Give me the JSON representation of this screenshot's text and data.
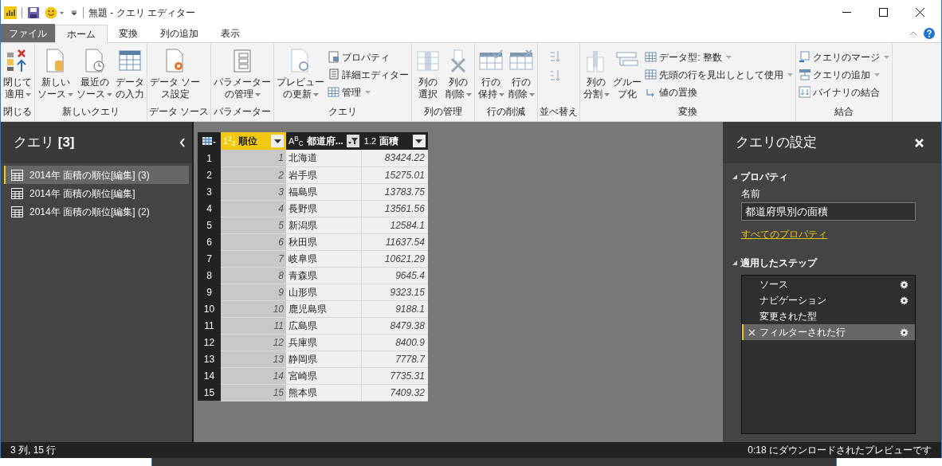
{
  "window": {
    "title": "無題 - クエリ エディター"
  },
  "tabs": [
    {
      "label": "ファイル",
      "kind": "file",
      "selected": false
    },
    {
      "label": "ホーム",
      "kind": "normal",
      "selected": true
    },
    {
      "label": "変換",
      "kind": "normal",
      "selected": false
    },
    {
      "label": "列の追加",
      "kind": "normal",
      "selected": false
    },
    {
      "label": "表示",
      "kind": "normal",
      "selected": false
    }
  ],
  "ribbon": [
    {
      "label": "閉じる",
      "items": [
        {
          "kind": "large",
          "lines": [
            "閉じて",
            "適用"
          ],
          "dropdown": true
        }
      ]
    },
    {
      "label": "新しいクエリ",
      "items": [
        {
          "kind": "large",
          "lines": [
            "新しい",
            "ソース"
          ],
          "dropdown": true
        },
        {
          "kind": "large",
          "lines": [
            "最近の",
            "ソース"
          ],
          "dropdown": true
        },
        {
          "kind": "large",
          "lines": [
            "データ",
            "の入力"
          ],
          "dropdown": false
        }
      ]
    },
    {
      "label": "データ ソース",
      "items": [
        {
          "kind": "large",
          "lines": [
            "データ ソー",
            "ス設定"
          ],
          "dropdown": false
        }
      ]
    },
    {
      "label": "パラメーター",
      "items": [
        {
          "kind": "large",
          "lines": [
            "パラメーター",
            "の管理"
          ],
          "dropdown": true
        }
      ]
    },
    {
      "label": "クエリ",
      "items": [
        {
          "kind": "large",
          "lines": [
            "プレビュー",
            "の更新"
          ],
          "dropdown": true
        },
        {
          "kind": "stack",
          "items": [
            {
              "label": "プロパティ",
              "dropdown": false
            },
            {
              "label": "詳細エディター",
              "dropdown": false
            },
            {
              "label": "管理",
              "dropdown": true
            }
          ]
        }
      ]
    },
    {
      "label": "列の管理",
      "items": [
        {
          "kind": "large",
          "lines": [
            "列の",
            "選択"
          ],
          "dropdown": false
        },
        {
          "kind": "large",
          "lines": [
            "列の",
            "削除"
          ],
          "dropdown": true
        }
      ]
    },
    {
      "label": "行の削減",
      "items": [
        {
          "kind": "large",
          "lines": [
            "行の",
            "保持"
          ],
          "dropdown": true
        },
        {
          "kind": "large",
          "lines": [
            "行の",
            "削除"
          ],
          "dropdown": true
        }
      ]
    },
    {
      "label": "並べ替え",
      "items": [
        {
          "kind": "sort"
        }
      ]
    },
    {
      "label": "変換",
      "items": [
        {
          "kind": "large",
          "lines": [
            "列の",
            "分割"
          ],
          "dropdown": true
        },
        {
          "kind": "large",
          "lines": [
            "グルー",
            "プ化"
          ],
          "dropdown": false
        },
        {
          "kind": "stack",
          "items": [
            {
              "label": "データ型: 整数",
              "dropdown": true
            },
            {
              "label": "先頭の行を見出しとして使用",
              "dropdown": true
            },
            {
              "label": "値の置換",
              "dropdown": false
            }
          ]
        }
      ]
    },
    {
      "label": "結合",
      "items": [
        {
          "kind": "stack",
          "items": [
            {
              "label": "クエリのマージ",
              "dropdown": true
            },
            {
              "label": "クエリの追加",
              "dropdown": true
            },
            {
              "label": "バイナリの結合",
              "dropdown": false
            }
          ]
        }
      ]
    }
  ],
  "queries": {
    "title": "クエリ **[3]**",
    "items": [
      {
        "label": "2014年 面積の順位[編集] (3)",
        "selected": true
      },
      {
        "label": "2014年 面積の順位[編集]",
        "selected": false
      },
      {
        "label": "2014年 面積の順位[編集] (2)",
        "selected": false
      }
    ]
  },
  "table": {
    "columns": [
      {
        "type": "1$^{2}$$_{3}$",
        "name": "順位",
        "selected": true,
        "filtered": false
      },
      {
        "type": "A$^{B}$$_{C}$",
        "name": "都道府...",
        "selected": false,
        "filtered": true
      },
      {
        "type": "1.2",
        "name": "面積",
        "selected": false,
        "filtered": false
      }
    ],
    "rows": [
      {
        "number": "1",
        "cells": [
          "1",
          "北海道",
          "83424.22"
        ]
      },
      {
        "number": "2",
        "cells": [
          "2",
          "岩手県",
          "15275.01"
        ]
      },
      {
        "number": "3",
        "cells": [
          "3",
          "福島県",
          "13783.75"
        ]
      },
      {
        "number": "4",
        "cells": [
          "4",
          "長野県",
          "13561.56"
        ]
      },
      {
        "number": "5",
        "cells": [
          "5",
          "新潟県",
          "12584.1"
        ]
      },
      {
        "number": "6",
        "cells": [
          "6",
          "秋田県",
          "11637.54"
        ]
      },
      {
        "number": "7",
        "cells": [
          "7",
          "岐阜県",
          "10621.29"
        ]
      },
      {
        "number": "8",
        "cells": [
          "8",
          "青森県",
          "9645.4"
        ]
      },
      {
        "number": "9",
        "cells": [
          "9",
          "山形県",
          "9323.15"
        ]
      },
      {
        "number": "10",
        "cells": [
          "10",
          "鹿児島県",
          "9188.1"
        ]
      },
      {
        "number": "11",
        "cells": [
          "11",
          "広島県",
          "8479.38"
        ]
      },
      {
        "number": "12",
        "cells": [
          "12",
          "兵庫県",
          "8400.9"
        ]
      },
      {
        "number": "13",
        "cells": [
          "13",
          "静岡県",
          "7778.7"
        ]
      },
      {
        "number": "14",
        "cells": [
          "14",
          "宮崎県",
          "7735.31"
        ]
      },
      {
        "number": "15",
        "cells": [
          "15",
          "熊本県",
          "7409.32"
        ]
      }
    ]
  },
  "settings": {
    "title": "クエリの設定",
    "properties_header": "プロパティ",
    "name_label": "名前",
    "name_value": "都道府県別の面積",
    "all_properties_link": "すべてのプロパティ",
    "steps_header": "適用したステップ",
    "steps": [
      {
        "label": "ソース",
        "gear": true,
        "selected": false
      },
      {
        "label": "ナビゲーション",
        "gear": true,
        "selected": false
      },
      {
        "label": "変更された型",
        "gear": false,
        "selected": false
      },
      {
        "label": "フィルターされた行",
        "gear": true,
        "selected": true
      }
    ]
  },
  "status_bar": {
    "left": "3 列, 15 行",
    "right": "0:18 にダウンロードされたプレビューです"
  }
}
